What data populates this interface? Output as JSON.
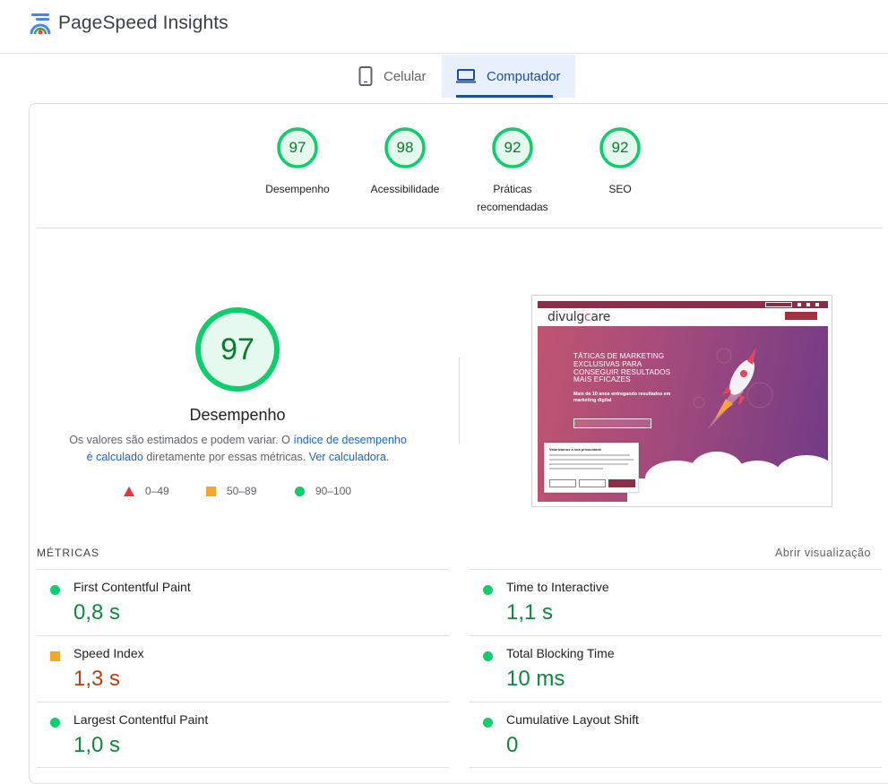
{
  "app": {
    "title": "PageSpeed Insights",
    "logo_icon": "pagespeed-logo-icon"
  },
  "tabs": [
    {
      "label": "Celular",
      "icon": "smartphone-icon",
      "active": false
    },
    {
      "label": "Computador",
      "icon": "laptop-icon",
      "active": true
    }
  ],
  "categories": [
    {
      "score": "97",
      "label": "Desempenho"
    },
    {
      "score": "98",
      "label": "Acessibilidade"
    },
    {
      "score": "92",
      "label": "Práticas recomendadas"
    },
    {
      "score": "92",
      "label": "SEO"
    }
  ],
  "performance": {
    "score": "97",
    "title": "Desempenho",
    "desc_part1": "Os valores são estimados e podem variar. O ",
    "desc_link1": "índice de desempenho é calculado",
    "desc_part2": " diretamente por essas métricas. ",
    "desc_link2": "Ver calculadora",
    "desc_part3": "."
  },
  "legend": [
    {
      "range": "0–49",
      "color": "#e8333d",
      "shape": "triangle"
    },
    {
      "range": "50–89",
      "color": "#f4a72a",
      "shape": "square"
    },
    {
      "range": "90–100",
      "color": "#0cce6b",
      "shape": "circle"
    }
  ],
  "preview": {
    "brand": "divulgcare",
    "hero_title": "TÁTICAS DE MARKETING EXCLUSIVAS PARA CONSEGUIR RESULTADOS MAIS EFICAZES",
    "hero_sub": "Mais de 10 anos entregando resultados em marketing digital",
    "cookie_title": "Valorizamos a sua privacidade"
  },
  "metrics": {
    "title": "MÉTRICAS",
    "toggle": "Abrir visualização",
    "items": [
      {
        "name": "First Contentful Paint",
        "value": "0,8 s",
        "status": "good"
      },
      {
        "name": "Time to Interactive",
        "value": "1,1 s",
        "status": "good"
      },
      {
        "name": "Speed Index",
        "value": "1,3 s",
        "status": "average"
      },
      {
        "name": "Total Blocking Time",
        "value": "10 ms",
        "status": "good"
      },
      {
        "name": "Largest Contentful Paint",
        "value": "1,0 s",
        "status": "good"
      },
      {
        "name": "Cumulative Layout Shift",
        "value": "0",
        "status": "good"
      }
    ]
  },
  "colors": {
    "good": "#0cce6b",
    "average": "#f4a72a",
    "poor": "#e8333d",
    "accent": "#1a4f9c"
  }
}
